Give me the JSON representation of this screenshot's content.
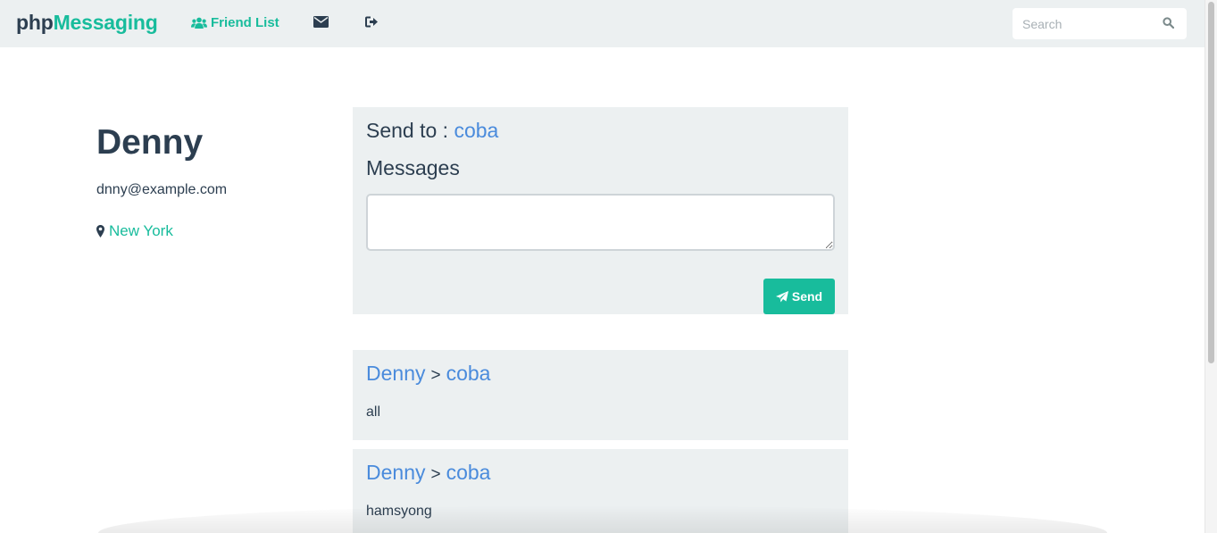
{
  "navbar": {
    "brand_prefix": "php",
    "brand_suffix": "Messaging",
    "friend_list_label": "Friend List",
    "search_placeholder": "Search"
  },
  "icons": {
    "friend_list": "users-icon",
    "messages": "envelope-icon",
    "logout": "sign-out-icon",
    "search": "search-icon",
    "location": "map-marker-icon",
    "send": "paper-plane-icon"
  },
  "colors": {
    "brand_dark": "#2c3e50",
    "accent": "#18bc9c",
    "link": "#4a8bdc",
    "panel_bg": "#ecf0f1"
  },
  "profile": {
    "name": "Denny",
    "email": "dnny@example.com",
    "location": "New York"
  },
  "compose": {
    "send_to_label": "Send to :",
    "recipient": "coba",
    "messages_label": "Messages",
    "message_value": "",
    "send_button": "Send"
  },
  "messages": [
    {
      "from": "Denny",
      "separator": ">",
      "to": "coba",
      "body": "all"
    },
    {
      "from": "Denny",
      "separator": ">",
      "to": "coba",
      "body": "hamsyong"
    }
  ]
}
